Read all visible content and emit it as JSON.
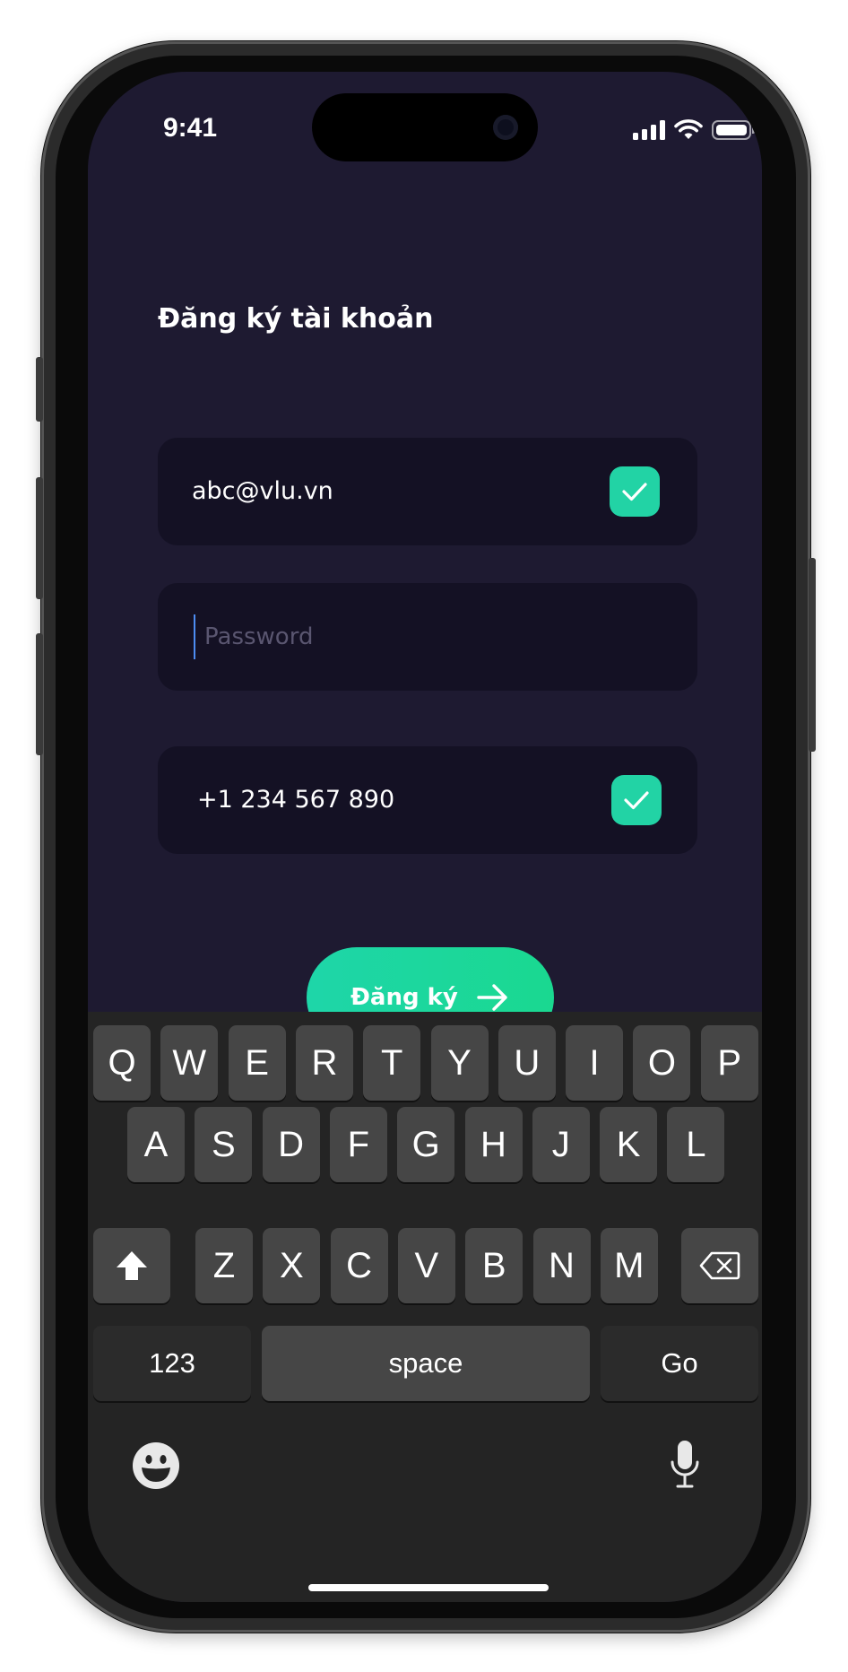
{
  "status_bar": {
    "time": "9:41"
  },
  "form": {
    "title": "Đăng ký tài khoản",
    "email_value": "abc@vlu.vn",
    "password_placeholder": "Password",
    "password_value": "",
    "phone_value": "+1 234 567 890",
    "submit_label": "Đăng ký"
  },
  "colors": {
    "background": "#1e1a31",
    "field_background": "#141124",
    "accent": "#22d3a5",
    "keyboard_background": "#242424"
  },
  "keyboard": {
    "row1": [
      "Q",
      "W",
      "E",
      "R",
      "T",
      "Y",
      "U",
      "I",
      "O",
      "P"
    ],
    "row2": [
      "A",
      "S",
      "D",
      "F",
      "G",
      "H",
      "J",
      "K",
      "L"
    ],
    "row3": [
      "Z",
      "X",
      "C",
      "V",
      "B",
      "N",
      "M"
    ],
    "numbers_label": "123",
    "space_label": "space",
    "go_label": "Go"
  },
  "icons": [
    "signal-icon",
    "wifi-icon",
    "battery-icon",
    "checkmark-icon",
    "arrow-right-icon",
    "shift-icon",
    "backspace-icon",
    "emoji-icon",
    "microphone-icon"
  ]
}
